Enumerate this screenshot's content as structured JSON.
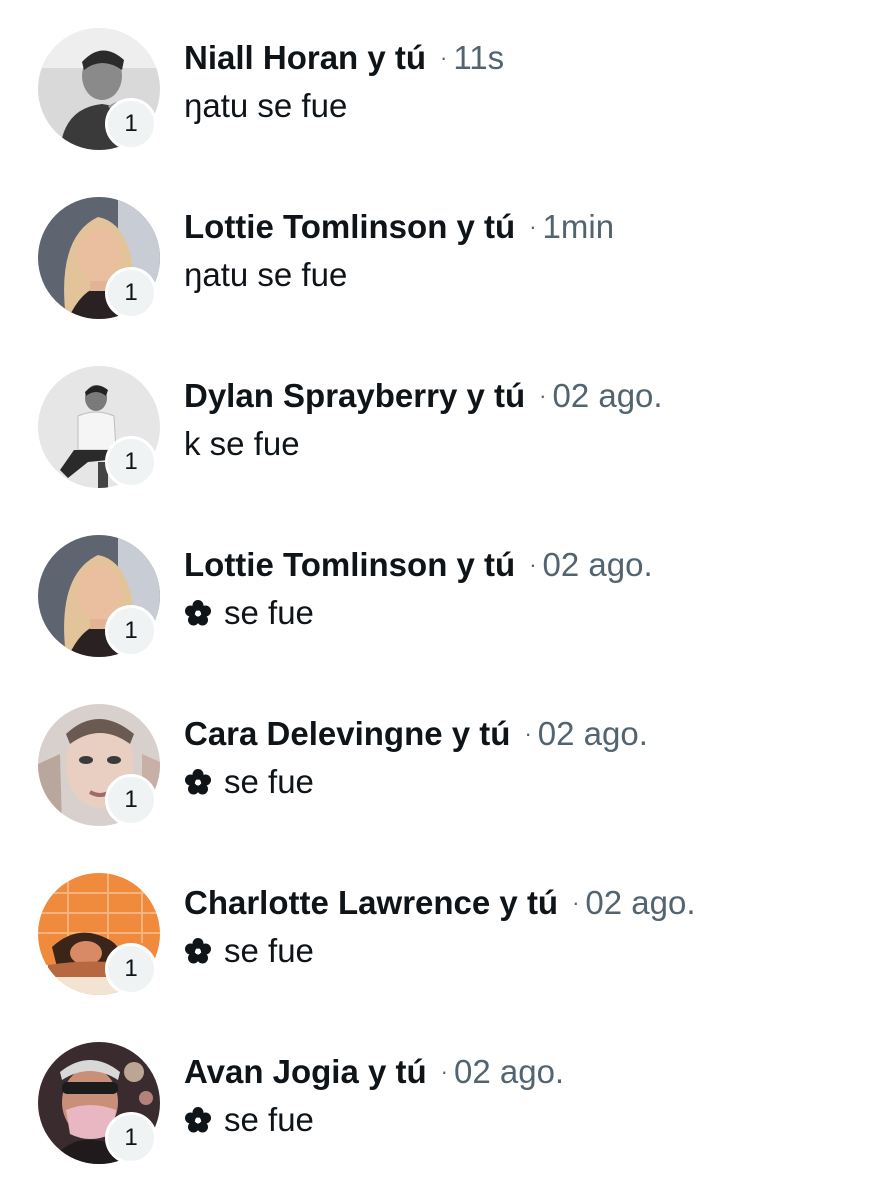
{
  "conversations": [
    {
      "names": "Niall Horan y tú",
      "time": "11s",
      "message": "ŋatu se fue",
      "has_flower": false,
      "badge": "1",
      "avatar_icon": "avatar-grayscale-man-photo",
      "avatar_colors": [
        "#d9d9d9",
        "#3a3a3a"
      ]
    },
    {
      "names": "Lottie Tomlinson y tú",
      "time": "1min",
      "message": "ŋatu se fue",
      "has_flower": false,
      "badge": "1",
      "avatar_icon": "avatar-blonde-woman-photo",
      "avatar_colors": [
        "#5e6470",
        "#e3c49a"
      ]
    },
    {
      "names": "Dylan Sprayberry y tú",
      "time": "02 ago.",
      "message": "k se fue",
      "has_flower": false,
      "badge": "1",
      "avatar_icon": "avatar-grayscale-seated-man-photo",
      "avatar_colors": [
        "#e6e6e6",
        "#2a2a2a"
      ]
    },
    {
      "names": "Lottie Tomlinson y tú",
      "time": "02 ago.",
      "message": "se fue",
      "has_flower": true,
      "badge": "1",
      "avatar_icon": "avatar-blonde-woman-photo",
      "avatar_colors": [
        "#5e6470",
        "#e3c49a"
      ]
    },
    {
      "names": "Cara Delevingne y tú",
      "time": "02 ago.",
      "message": "se fue",
      "has_flower": true,
      "badge": "1",
      "avatar_icon": "avatar-woman-closeup-photo",
      "avatar_colors": [
        "#d8d0cc",
        "#6b5a52"
      ]
    },
    {
      "names": "Charlotte Lawrence y tú",
      "time": "02 ago.",
      "message": "se fue",
      "has_flower": true,
      "badge": "1",
      "avatar_icon": "avatar-orange-tiles-woman-photo",
      "avatar_colors": [
        "#f08a3c",
        "#3b2418"
      ]
    },
    {
      "names": "Avan Jogia y tú",
      "time": "02 ago.",
      "message": "se fue",
      "has_flower": true,
      "badge": "1",
      "avatar_icon": "avatar-masked-man-photo",
      "avatar_colors": [
        "#3a2c2e",
        "#e9b7c2"
      ]
    }
  ],
  "icons": {
    "separator": "·",
    "message_flower": "flower-icon"
  },
  "colors": {
    "primary_text": "#0f1419",
    "secondary_text": "#536471",
    "badge_bg": "#eff3f4"
  }
}
